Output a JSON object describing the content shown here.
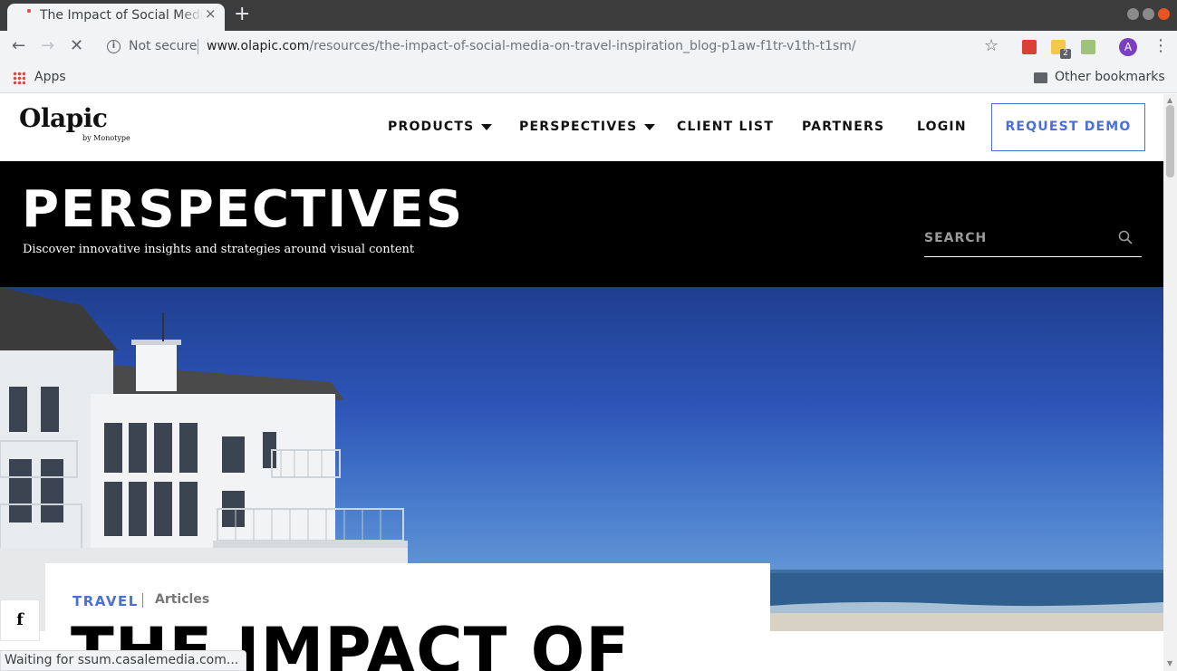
{
  "browser": {
    "tab_title": "The Impact of Social Media",
    "tab_close": "×",
    "new_tab": "+",
    "security_label": "Not secure",
    "url_host": "www.olapic.com",
    "url_path": "/resources/the-impact-of-social-media-on-travel-inspiration_blog-p1aw-f1tr-v1th-t1sm/",
    "extension_badge": "2",
    "profile_initial": "A",
    "bookmarks": {
      "apps_label": "Apps",
      "other_label": "Other bookmarks"
    },
    "status_text": "Waiting for ssum.casalemedia.com..."
  },
  "site": {
    "logo": "Olapic",
    "logo_sub": "by Monotype",
    "nav": {
      "products": "PRODUCTS",
      "perspectives": "PERSPECTIVES",
      "client_list": "CLIENT LIST",
      "partners": "PARTNERS",
      "login": "LOGIN",
      "request_demo": "REQUEST DEMO"
    },
    "hero": {
      "title": "PERSPECTIVES",
      "subtitle": "Discover innovative insights and strategies around visual content",
      "search_placeholder": "SEARCH"
    },
    "article": {
      "category": "TRAVEL",
      "type": "Articles",
      "title": "THE IMPACT OF"
    },
    "share": {
      "facebook": "f"
    }
  },
  "colors": {
    "accent": "#4a6fd8",
    "hero_bg": "#000000",
    "sky": "#2d55b8"
  }
}
